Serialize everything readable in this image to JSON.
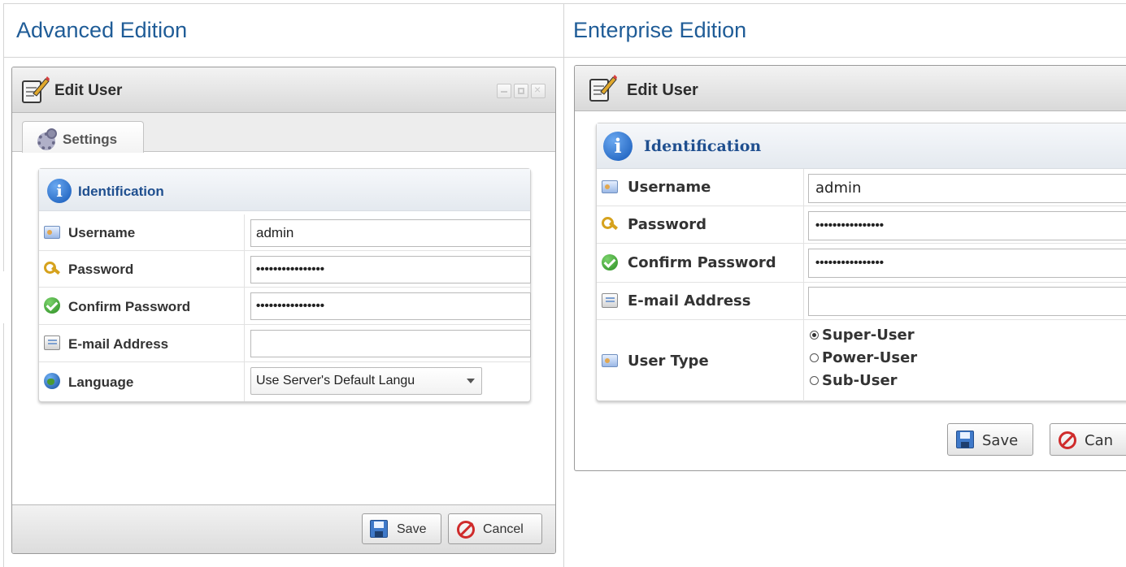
{
  "columns": {
    "left_title": "Advanced Edition",
    "right_title": "Enterprise Edition"
  },
  "advanced": {
    "window_title": "Edit User",
    "tab_settings": "Settings",
    "section_title": "Identification",
    "fields": {
      "username_label": "Username",
      "username_value": "admin",
      "password_label": "Password",
      "password_value": "••••••••••••••••",
      "confirm_label": "Confirm Password",
      "confirm_value": "••••••••••••••••",
      "email_label": "E-mail Address",
      "email_value": "",
      "language_label": "Language",
      "language_value": "Use Server's Default Langu"
    },
    "buttons": {
      "save": "Save",
      "cancel": "Cancel"
    }
  },
  "enterprise": {
    "window_title": "Edit User",
    "section_title": "Identification",
    "fields": {
      "username_label": "Username",
      "username_value": "admin",
      "password_label": "Password",
      "password_value": "••••••••••••••••",
      "confirm_label": "Confirm Password",
      "confirm_value": "••••••••••••••••",
      "email_label": "E-mail Address",
      "email_value": "",
      "user_type_label": "User Type",
      "user_type_options": [
        "Super-User",
        "Power-User",
        "Sub-User"
      ],
      "user_type_selected": "Super-User"
    },
    "buttons": {
      "save": "Save",
      "cancel": "Can"
    }
  },
  "icons": {
    "window": "edit-user-icon",
    "settings_tab": "gear-icon",
    "section": "info-icon",
    "username": "id-card-icon",
    "password": "key-icon",
    "confirm": "check-icon",
    "email": "mail-icon",
    "language": "globe-icon",
    "save": "floppy-disk-icon",
    "cancel": "no-entry-icon"
  }
}
